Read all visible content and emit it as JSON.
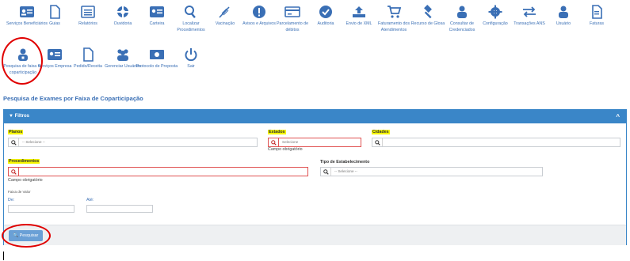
{
  "menu": {
    "row1": [
      {
        "label": "Serviços Beneficiários",
        "icon": "id-card-icon"
      },
      {
        "label": "Guias",
        "icon": "document-icon"
      },
      {
        "label": "Relatórios",
        "icon": "list-icon"
      },
      {
        "label": "Ouvidoria",
        "icon": "support-icon"
      },
      {
        "label": "Carteira",
        "icon": "id-card-icon"
      },
      {
        "label": "Localizar Procedimentos",
        "icon": "search-icon"
      },
      {
        "label": "Vacinação",
        "icon": "syringe-icon"
      },
      {
        "label": "Avisos e Arquivos",
        "icon": "alert-icon"
      },
      {
        "label": "Parcelamento de débitos",
        "icon": "card-icon"
      },
      {
        "label": "Auditoria",
        "icon": "check-circle-icon"
      },
      {
        "label": "Envio de XML",
        "icon": "upload-icon"
      },
      {
        "label": "Faturamento dos Atendimentos",
        "icon": "cart-icon"
      },
      {
        "label": "Recurso de Glosa",
        "icon": "gavel-icon"
      },
      {
        "label": "Consultar de Credenciados",
        "icon": "users-icon"
      },
      {
        "label": "Configuração",
        "icon": "gear-icon"
      },
      {
        "label": "Transações ANS",
        "icon": "arrows-icon"
      },
      {
        "label": "Usuário",
        "icon": "user-icon"
      },
      {
        "label": "Faturas",
        "icon": "invoice-icon"
      }
    ],
    "row2": [
      {
        "label": "Pesquisa de faixa de coparticipação",
        "icon": "user-lock-icon"
      },
      {
        "label": "Serviços Empresa",
        "icon": "id-card-icon"
      },
      {
        "label": "Pedido/Receita",
        "icon": "document-icon"
      },
      {
        "label": "Gerenciar Usuários",
        "icon": "users-icon"
      },
      {
        "label": "Protocolo de Proposta",
        "icon": "money-icon"
      },
      {
        "label": "Sair",
        "icon": "power-icon"
      }
    ]
  },
  "page": {
    "title": "Pesquisa de Exames por Faixa de Coparticipação"
  },
  "filters": {
    "header": "Filtros",
    "toggle": "^",
    "planos": {
      "label": "Planos",
      "placeholder": "-- Selecione --"
    },
    "estados": {
      "label": "Estados",
      "placeholder": "Selecione",
      "error": "Campo obrigatório"
    },
    "cidades": {
      "label": "Cidades",
      "placeholder": ""
    },
    "procedimentos": {
      "label": "Procedimentos",
      "placeholder": "",
      "error": "Campo obrigatório"
    },
    "tipo_estabelecimento": {
      "label": "Tipo de Estabelecimento",
      "placeholder": "-- Selecione --"
    },
    "faixa_valor": {
      "label": "Faixa de Valor",
      "de_label": "De:",
      "ate_label": "Até:"
    }
  },
  "actions": {
    "search_label": "Pesquisar"
  },
  "colors": {
    "accent": "#3a86c8",
    "link": "#3a6fb5",
    "highlight": "#f6f600",
    "annotation": "#e00000"
  }
}
